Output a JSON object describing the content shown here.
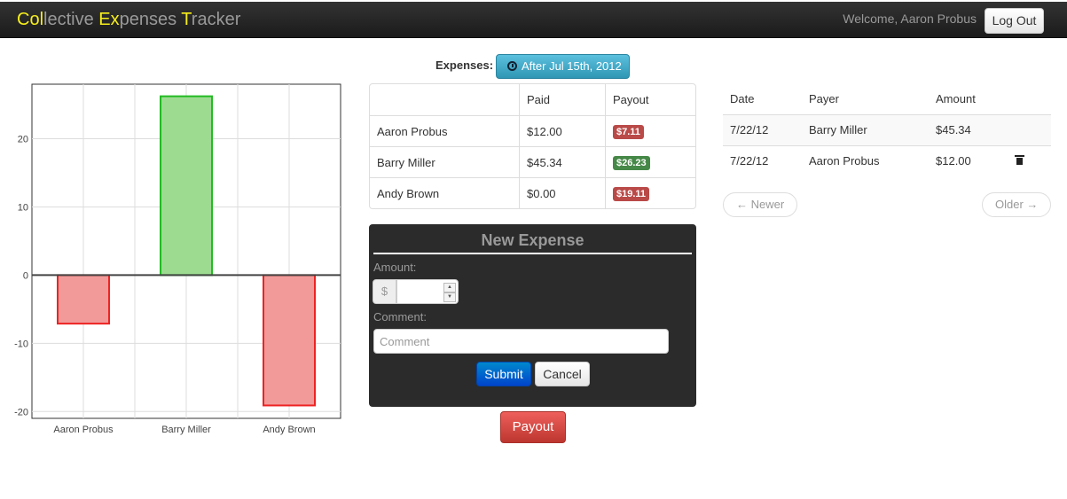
{
  "navbar": {
    "brand_parts": [
      {
        "text": "Col",
        "hl": true
      },
      {
        "text": "lective ",
        "hl": false
      },
      {
        "text": "Ex",
        "hl": true
      },
      {
        "text": "penses ",
        "hl": false
      },
      {
        "text": "T",
        "hl": true
      },
      {
        "text": "racker",
        "hl": false
      }
    ],
    "welcome": "Welcome, Aaron Probus",
    "logout_label": "Log Out"
  },
  "colors": {
    "brand_highlight": "#f6ee1a",
    "positive_fill": "#9ddb91",
    "positive_stroke": "#22bb22",
    "negative_fill": "#f29a9a",
    "negative_stroke": "#ee2222"
  },
  "chart_data": {
    "type": "bar",
    "categories": [
      "Aaron Probus",
      "Barry Miller",
      "Andy Brown"
    ],
    "values": [
      -7.11,
      26.23,
      -19.11
    ],
    "ylim": [
      -21,
      28
    ],
    "yticks": [
      -20,
      -10,
      0,
      10,
      20
    ],
    "grid": true,
    "title": "",
    "xlabel": "",
    "ylabel": ""
  },
  "expenses": {
    "label": "Expenses:",
    "date_filter": "After Jul 15th, 2012",
    "columns": [
      "",
      "Paid",
      "Payout"
    ],
    "rows": [
      {
        "name": "Aaron Probus",
        "paid": "$12.00",
        "payout": "$7.11",
        "status": "neg"
      },
      {
        "name": "Barry Miller",
        "paid": "$45.34",
        "payout": "$26.23",
        "status": "pos"
      },
      {
        "name": "Andy Brown",
        "paid": "$0.00",
        "payout": "$19.11",
        "status": "neg"
      }
    ]
  },
  "form": {
    "title": "New Expense",
    "amount_label": "Amount:",
    "currency": "$",
    "comment_label": "Comment:",
    "comment_placeholder": "Comment",
    "submit_label": "Submit",
    "cancel_label": "Cancel"
  },
  "payout_label": "Payout",
  "expense_list": {
    "columns": [
      "Date",
      "Payer",
      "Amount"
    ],
    "rows": [
      {
        "date": "7/22/12",
        "payer": "Barry Miller",
        "amount": "$45.34",
        "deletable": false
      },
      {
        "date": "7/22/12",
        "payer": "Aaron Probus",
        "amount": "$12.00",
        "deletable": true
      }
    ],
    "newer_label": "← Newer",
    "older_label": "Older →"
  }
}
